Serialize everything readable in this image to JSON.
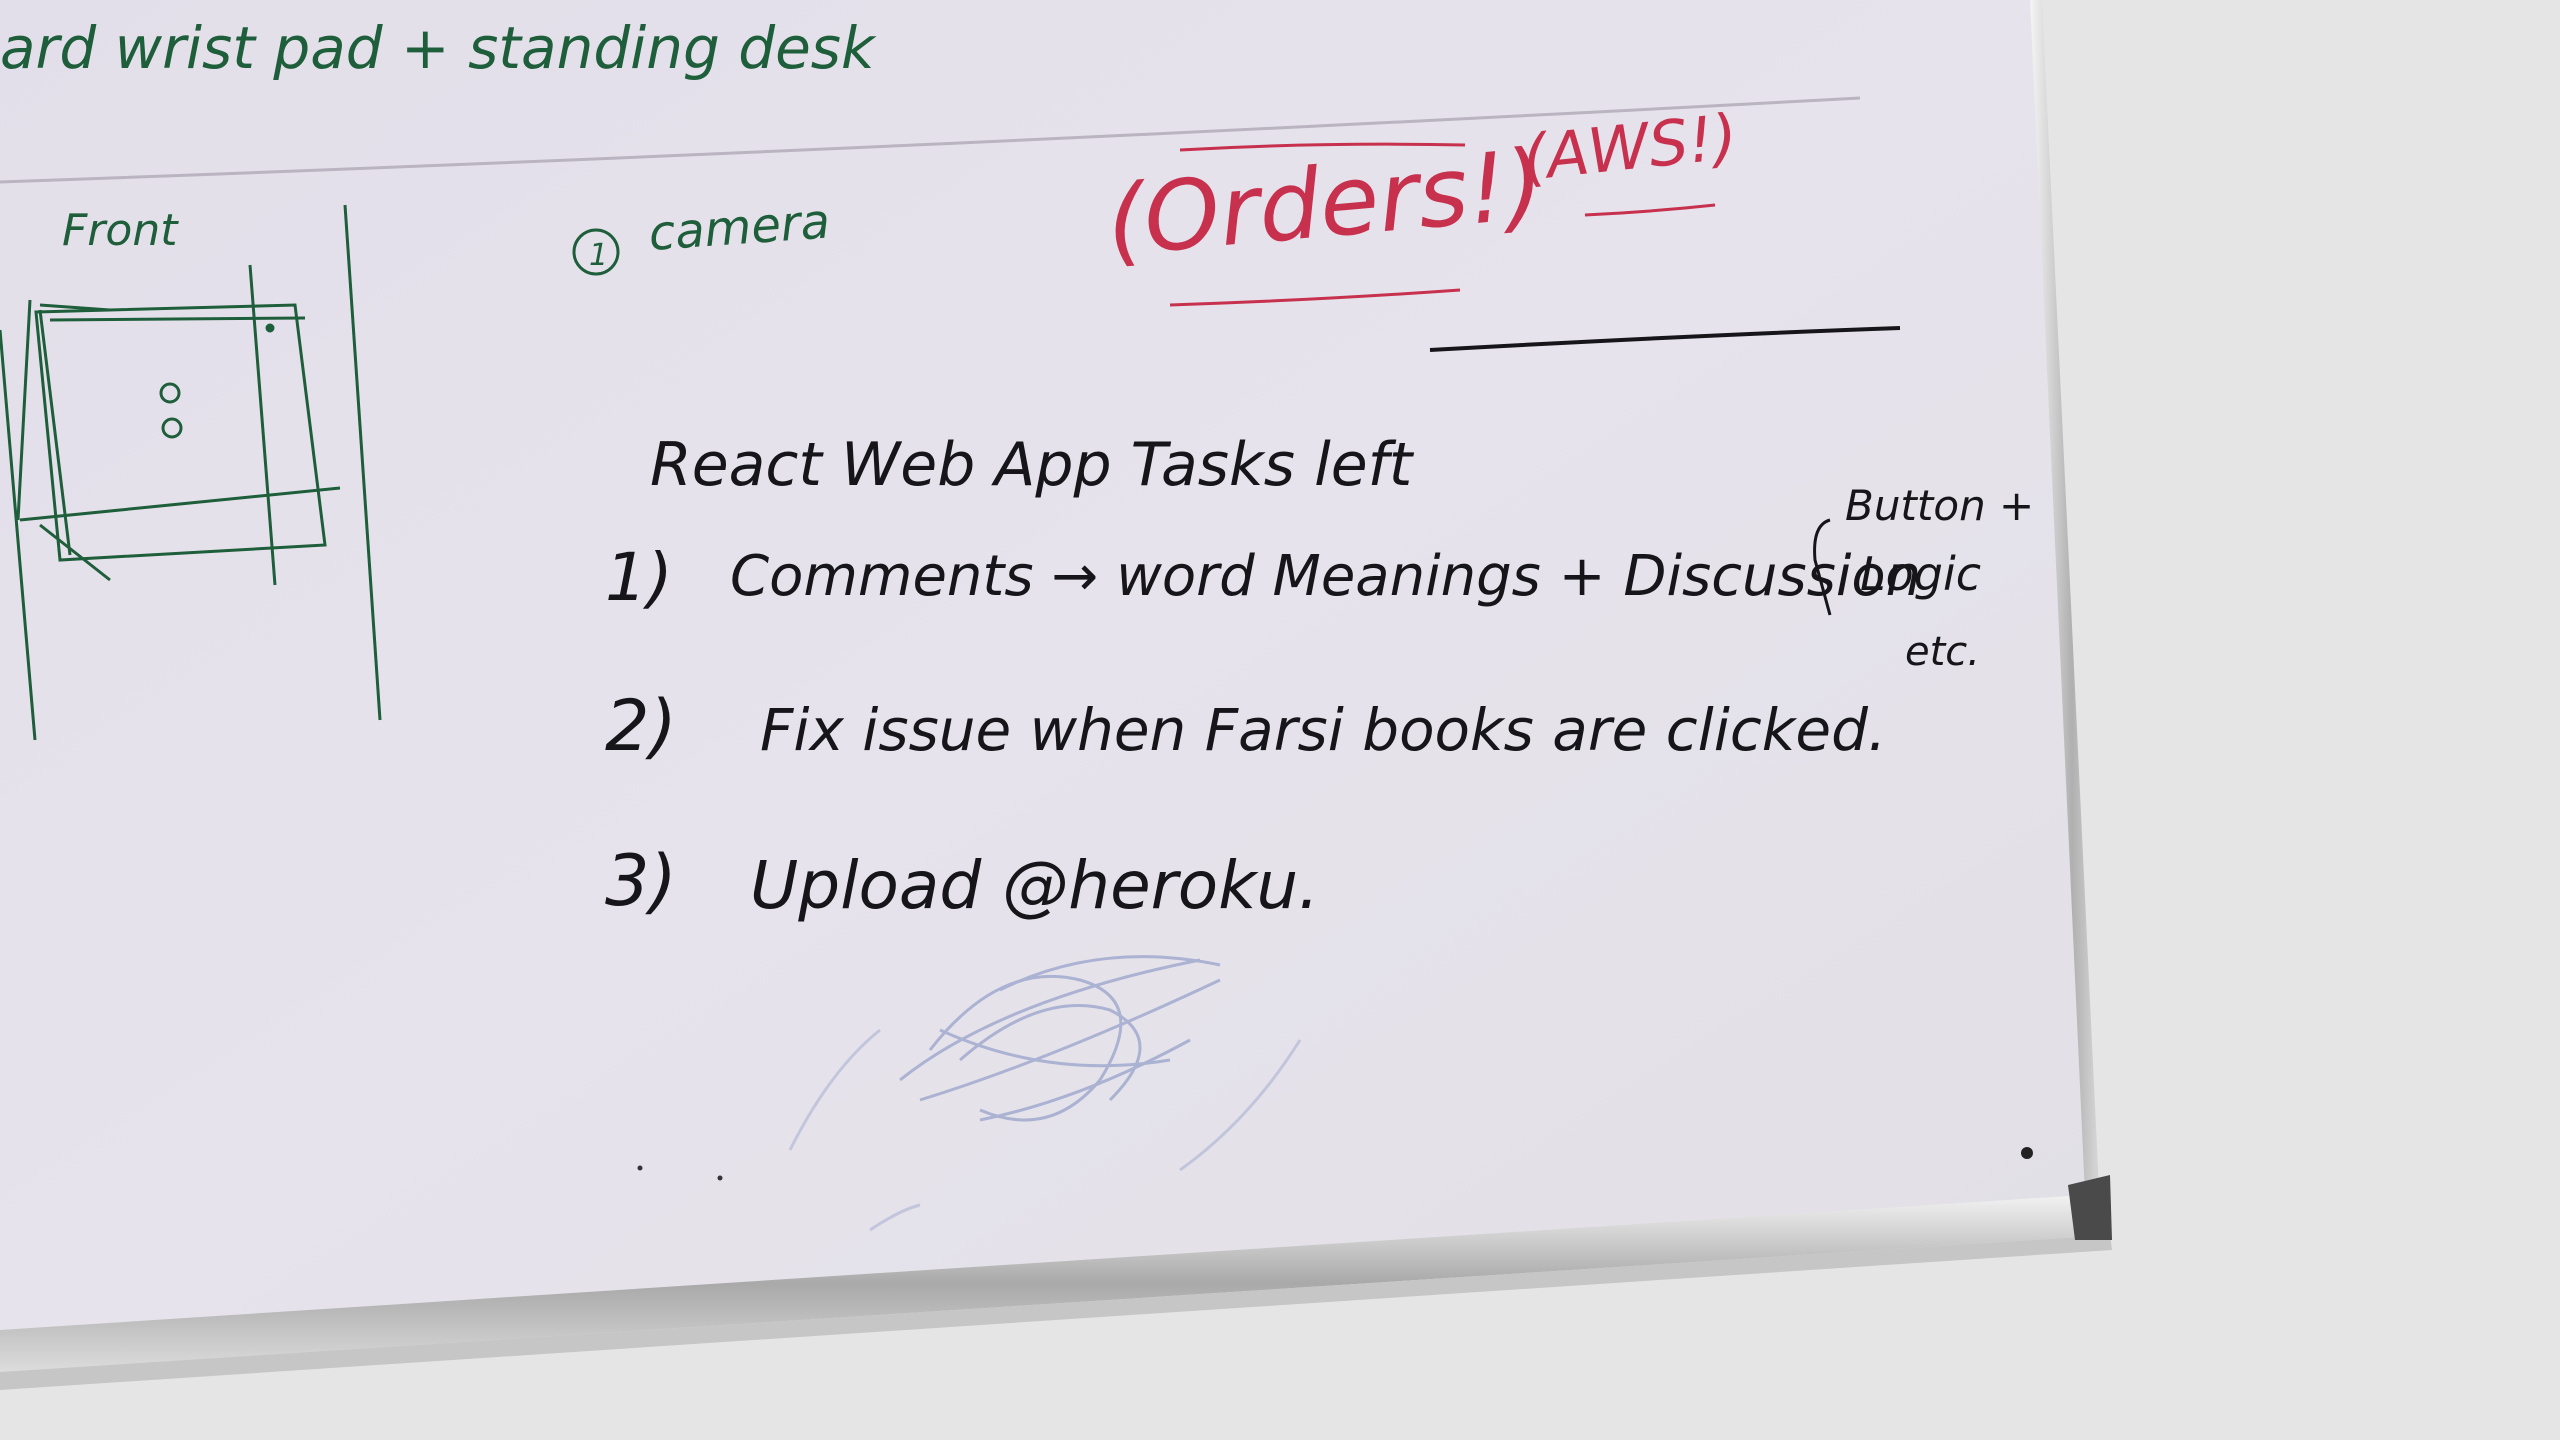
{
  "whiteboard": {
    "top_note": "ard wrist pad + standing desk",
    "sketch_label": "Front",
    "camera_note": "1 camera",
    "camera_number": "1",
    "camera_word": "camera",
    "orders_note": "(Orders!)",
    "aws_note": "(AWS!)",
    "heading": "React Web App Tasks left",
    "tasks": [
      {
        "num": "1)",
        "text": "Comments → word Meanings + Discussion"
      },
      {
        "num": "2)",
        "text": "Fix issue when Farsi books are clicked."
      },
      {
        "num": "3)",
        "text": "Upload @heroku."
      }
    ],
    "side_note": [
      "Button +",
      "Logic",
      "etc."
    ]
  },
  "colors": {
    "board": "#e4e1ea",
    "green_ink": "#1e5e3a",
    "red_ink": "#c8314e",
    "black_ink": "#16161a",
    "blue_smudge": "#7c8cc0",
    "wall": "#e6e6e6",
    "frame": "#bdbdbd"
  }
}
